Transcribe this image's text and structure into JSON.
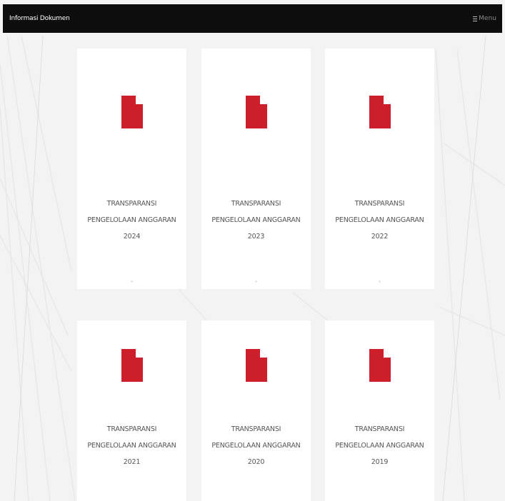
{
  "header": {
    "title": "Informasi Dokumen",
    "menu_label": "Menu"
  },
  "colors": {
    "header_bg": "#0d0d0d",
    "document_icon": "#cc1f2b",
    "card_bg": "#ffffff"
  },
  "documents": [
    {
      "line1": "TRANSPARANSI",
      "line2": "PENGELOLAAN ANGGARAN",
      "year": "2024",
      "icon": "document-icon"
    },
    {
      "line1": "TRANSPARANSI",
      "line2": "PENGELOLAAN ANGGARAN",
      "year": "2023",
      "icon": "document-icon"
    },
    {
      "line1": "TRANSPARANSI",
      "line2": "PENGELOLAAN ANGGARAN",
      "year": "2022",
      "icon": "document-icon"
    },
    {
      "line1": "TRANSPARANSI",
      "line2": "PENGELOLAAN ANGGARAN",
      "year": "2021",
      "icon": "document-icon"
    },
    {
      "line1": "TRANSPARANSI",
      "line2": "PENGELOLAAN ANGGARAN",
      "year": "2020",
      "icon": "document-icon"
    },
    {
      "line1": "TRANSPARANSI",
      "line2": "PENGELOLAAN ANGGARAN",
      "year": "2019",
      "icon": "document-icon"
    }
  ]
}
